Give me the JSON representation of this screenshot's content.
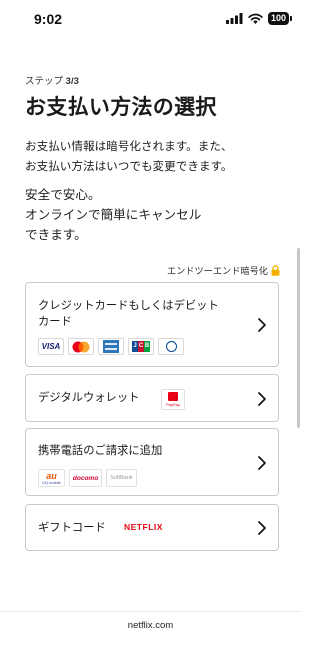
{
  "status_bar": {
    "time": "9:02",
    "battery": "100",
    "icons": [
      "signal-icon",
      "wifi-icon",
      "battery-icon"
    ]
  },
  "header": {
    "step_prefix": "ステップ",
    "step_value": "3/3",
    "title": "お支払い方法の選択"
  },
  "description": {
    "line1": "お支払い情報は暗号化されます。また、",
    "line2": "お支払い方法はいつでも変更できます。"
  },
  "safety": {
    "line1": "安全で安心。",
    "line2": "オンラインで簡単にキャンセル",
    "line3": "できます。"
  },
  "encryption": {
    "label": "エンドツーエンド暗号化",
    "icon": "lock-icon",
    "icon_color": "#f5b000"
  },
  "payment_options": {
    "card": {
      "label_line1": "クレジットカードもしくはデビット",
      "label_line2": "カード",
      "logos": {
        "visa": "VISA",
        "jcb": [
          "J",
          "C",
          "B"
        ]
      }
    },
    "wallet": {
      "label": "デジタルウォレット",
      "logo_text": "PayPay"
    },
    "carrier": {
      "label": "携帯電話のご請求に追加",
      "logos": {
        "au": "au",
        "uq": "UQ mobile",
        "docomo": "docomo",
        "softbank": "SoftBank"
      }
    },
    "gift": {
      "label": "ギフトコード",
      "logo_text": "NETFLIX"
    }
  },
  "footer": {
    "domain": "netflix.com"
  },
  "colors": {
    "border": "#c9c9c9",
    "netflix_red": "#e50914",
    "text": "#1a1a1a"
  }
}
